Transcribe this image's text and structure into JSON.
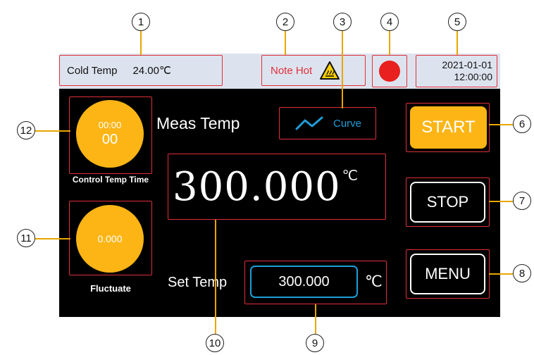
{
  "callouts": [
    "1",
    "2",
    "3",
    "4",
    "5",
    "6",
    "7",
    "8",
    "9",
    "10",
    "11",
    "12"
  ],
  "topbar": {
    "cold_temp_label": "Cold Temp",
    "cold_temp_value": "24.00℃",
    "note_label": "Note Hot",
    "warning_icon": "hot-surface-warning",
    "status_color": "#e8201f",
    "date": "2021-01-01",
    "time": "12:00:00"
  },
  "main": {
    "meas_temp_label": "Meas Temp",
    "curve_label": "Curve",
    "measured_value": "300.000",
    "measured_unit": "℃",
    "set_temp_label": "Set Temp",
    "set_temp_value": "300.000",
    "set_temp_unit": "℃",
    "timer_time": "00:00",
    "timer_count": "00",
    "timer_caption": "Control Temp Time",
    "fluctuate_value": "0.000",
    "fluctuate_caption": "Fluctuate"
  },
  "buttons": {
    "start": "START",
    "stop": "STOP",
    "menu": "MENU"
  },
  "colors": {
    "accent_yellow": "#fdb515",
    "callout_red": "#e0303a",
    "curve_blue": "#1e9fd8"
  }
}
